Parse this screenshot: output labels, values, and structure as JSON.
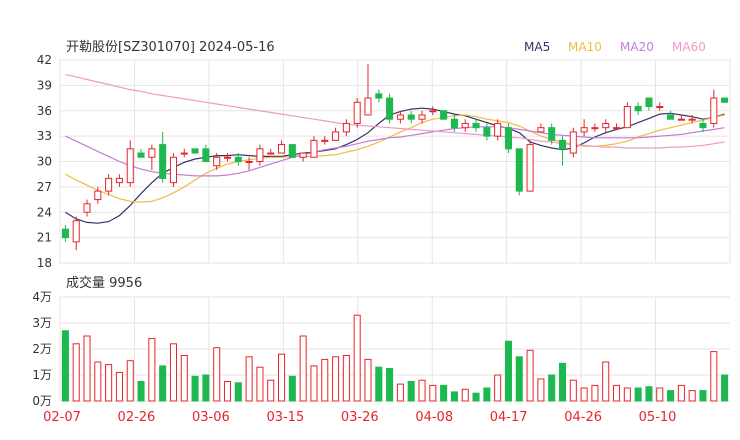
{
  "title": "开勒股份[SZ301070] 2024-05-16",
  "volume_title": "成交量 9956",
  "legend": [
    {
      "label": "MA5",
      "color": "#333366"
    },
    {
      "label": "MA10",
      "color": "#f5b942"
    },
    {
      "label": "MA20",
      "color": "#c27ed6"
    },
    {
      "label": "MA60",
      "color": "#f09ac8"
    }
  ],
  "colors": {
    "up": "#e8242a",
    "down": "#1fb850",
    "grid": "#e5e5e5"
  },
  "chart_data": [
    {
      "type": "candlestick",
      "ylim": [
        18,
        42
      ],
      "yticks": [
        "42",
        "39",
        "36",
        "33",
        "30",
        "27",
        "24",
        "21",
        "18"
      ],
      "xticks": [
        "02-07",
        "02-26",
        "03-06",
        "03-15",
        "03-26",
        "04-08",
        "04-17",
        "04-26",
        "05-10"
      ],
      "ohlc": [
        [
          22.0,
          22.5,
          20.5,
          21.0
        ],
        [
          20.5,
          23.5,
          19.5,
          23.0
        ],
        [
          24.0,
          25.5,
          23.5,
          25.0
        ],
        [
          25.5,
          27.0,
          25.0,
          26.5
        ],
        [
          26.5,
          28.5,
          26.0,
          28.0
        ],
        [
          27.5,
          28.5,
          27.0,
          28.0
        ],
        [
          27.5,
          32.5,
          27.0,
          31.5
        ],
        [
          31.0,
          31.5,
          30.5,
          30.5
        ],
        [
          30.5,
          32.0,
          29.0,
          31.5
        ],
        [
          32.0,
          33.5,
          27.5,
          28.0
        ],
        [
          27.5,
          31.0,
          27.0,
          30.5
        ],
        [
          31.0,
          31.5,
          30.5,
          31.0
        ],
        [
          31.5,
          31.5,
          31.0,
          31.0
        ],
        [
          31.5,
          32.0,
          30.0,
          30.0
        ],
        [
          29.5,
          31.0,
          29.0,
          30.5
        ],
        [
          30.5,
          31.0,
          30.0,
          30.5
        ],
        [
          30.5,
          31.0,
          29.5,
          30.0
        ],
        [
          30.0,
          30.5,
          29.0,
          30.0
        ],
        [
          30.0,
          32.0,
          29.5,
          31.5
        ],
        [
          31.0,
          31.5,
          31.0,
          31.0
        ],
        [
          31.0,
          32.5,
          31.0,
          32.0
        ],
        [
          32.0,
          32.0,
          30.5,
          30.5
        ],
        [
          30.5,
          31.0,
          30.0,
          31.0
        ],
        [
          30.5,
          33.0,
          30.5,
          32.5
        ],
        [
          32.5,
          33.0,
          32.0,
          32.5
        ],
        [
          32.5,
          34.0,
          32.5,
          33.5
        ],
        [
          33.5,
          35.0,
          33.0,
          34.5
        ],
        [
          34.5,
          37.5,
          34.0,
          37.0
        ],
        [
          35.5,
          41.5,
          35.5,
          37.5
        ],
        [
          38.0,
          38.5,
          37.0,
          37.5
        ],
        [
          37.5,
          38.0,
          34.5,
          35.0
        ],
        [
          35.0,
          36.0,
          34.5,
          35.5
        ],
        [
          35.5,
          36.0,
          34.5,
          35.0
        ],
        [
          35.0,
          36.0,
          34.5,
          35.5
        ],
        [
          36.0,
          36.5,
          35.5,
          36.0
        ],
        [
          36.0,
          36.0,
          35.0,
          35.0
        ],
        [
          35.0,
          35.5,
          33.5,
          34.0
        ],
        [
          34.0,
          35.0,
          33.5,
          34.5
        ],
        [
          34.5,
          35.0,
          33.5,
          34.0
        ],
        [
          34.0,
          34.5,
          32.5,
          33.0
        ],
        [
          33.0,
          35.0,
          32.5,
          34.5
        ],
        [
          34.0,
          34.5,
          31.0,
          31.5
        ],
        [
          31.5,
          31.5,
          26.0,
          26.5
        ],
        [
          26.5,
          32.5,
          26.5,
          32.0
        ],
        [
          33.5,
          34.5,
          33.5,
          34.0
        ],
        [
          34.0,
          34.5,
          32.0,
          32.5
        ],
        [
          32.5,
          33.0,
          29.5,
          31.5
        ],
        [
          31.0,
          34.0,
          30.5,
          33.5
        ],
        [
          33.5,
          35.0,
          33.0,
          34.0
        ],
        [
          34.0,
          34.5,
          33.5,
          34.0
        ],
        [
          34.0,
          35.0,
          33.5,
          34.5
        ],
        [
          34.0,
          34.5,
          34.0,
          34.0
        ],
        [
          34.0,
          37.0,
          34.0,
          36.5
        ],
        [
          36.5,
          37.0,
          35.5,
          36.0
        ],
        [
          37.5,
          37.5,
          36.0,
          36.5
        ],
        [
          36.5,
          37.0,
          36.0,
          36.5
        ],
        [
          35.5,
          36.0,
          35.0,
          35.0
        ],
        [
          35.0,
          35.5,
          35.0,
          35.0
        ],
        [
          35.0,
          35.5,
          34.5,
          35.0
        ],
        [
          34.5,
          35.0,
          33.5,
          34.0
        ],
        [
          34.5,
          38.5,
          34.0,
          37.5
        ],
        [
          37.5,
          37.5,
          37.0,
          37.0
        ]
      ],
      "series": [
        {
          "name": "MA5",
          "values": [
            24.0,
            23.2,
            22.8,
            22.7,
            22.9,
            23.6,
            24.8,
            26.2,
            27.5,
            28.6,
            29.3,
            29.9,
            30.3,
            30.5,
            30.7,
            30.7,
            30.8,
            30.7,
            30.6,
            30.6,
            30.6,
            30.8,
            31.0,
            31.1,
            31.3,
            31.5,
            32.0,
            32.6,
            33.4,
            34.5,
            35.5,
            35.9,
            36.2,
            36.3,
            36.2,
            35.9,
            35.6,
            35.4,
            35.0,
            34.6,
            34.2,
            33.9,
            33.4,
            32.3,
            31.9,
            31.6,
            31.4,
            31.6,
            32.2,
            32.9,
            33.4,
            33.8,
            34.1,
            34.6,
            35.1,
            35.6,
            35.7,
            35.5,
            35.3,
            35.0,
            35.2,
            35.6
          ]
        },
        {
          "name": "MA10",
          "values": [
            28.5,
            27.8,
            27.2,
            26.6,
            26.1,
            25.6,
            25.3,
            25.2,
            25.3,
            25.7,
            26.3,
            27.0,
            27.8,
            28.6,
            29.2,
            29.7,
            30.0,
            30.2,
            30.4,
            30.5,
            30.5,
            30.6,
            30.6,
            30.6,
            30.7,
            30.8,
            31.1,
            31.4,
            31.8,
            32.3,
            32.9,
            33.5,
            34.0,
            34.6,
            35.0,
            35.2,
            35.4,
            35.5,
            35.3,
            35.0,
            34.8,
            34.6,
            34.2,
            33.6,
            33.0,
            32.6,
            32.3,
            32.0,
            31.8,
            31.8,
            31.9,
            32.1,
            32.4,
            32.9,
            33.3,
            33.7,
            34.0,
            34.3,
            34.6,
            34.9,
            35.2,
            35.5
          ]
        },
        {
          "name": "MA20",
          "values": [
            33.0,
            32.4,
            31.8,
            31.2,
            30.6,
            30.0,
            29.5,
            29.1,
            28.8,
            28.6,
            28.5,
            28.4,
            28.3,
            28.3,
            28.3,
            28.4,
            28.6,
            28.9,
            29.3,
            29.7,
            30.1,
            30.5,
            30.8,
            31.1,
            31.4,
            31.6,
            31.8,
            32.1,
            32.4,
            32.6,
            32.8,
            32.9,
            33.1,
            33.3,
            33.5,
            33.7,
            33.9,
            34.0,
            34.1,
            34.1,
            34.1,
            34.0,
            33.8,
            33.6,
            33.4,
            33.2,
            33.1,
            33.0,
            32.9,
            32.8,
            32.8,
            32.8,
            32.8,
            32.8,
            32.9,
            33.0,
            33.1,
            33.2,
            33.4,
            33.6,
            33.8,
            34.0
          ]
        },
        {
          "name": "MA60",
          "values": [
            40.3,
            40.0,
            39.7,
            39.4,
            39.1,
            38.8,
            38.5,
            38.3,
            38.0,
            37.8,
            37.6,
            37.4,
            37.2,
            37.0,
            36.8,
            36.6,
            36.4,
            36.2,
            36.0,
            35.8,
            35.6,
            35.4,
            35.2,
            35.0,
            34.8,
            34.6,
            34.4,
            34.3,
            34.2,
            34.1,
            34.0,
            33.9,
            33.8,
            33.7,
            33.6,
            33.5,
            33.4,
            33.3,
            33.2,
            33.1,
            33.0,
            32.9,
            32.8,
            32.6,
            32.4,
            32.3,
            32.1,
            32.0,
            31.9,
            31.8,
            31.7,
            31.7,
            31.6,
            31.6,
            31.6,
            31.6,
            31.7,
            31.7,
            31.8,
            31.9,
            32.1,
            32.3
          ]
        }
      ]
    },
    {
      "type": "bar",
      "ylim": [
        0,
        40000
      ],
      "yticks": [
        "4万",
        "3万",
        "2万",
        "1万",
        "0万"
      ],
      "values": [
        27000,
        22000,
        25000,
        15000,
        14000,
        11000,
        15500,
        7500,
        24000,
        13500,
        22000,
        17500,
        9500,
        10000,
        20500,
        7500,
        7000,
        17000,
        13000,
        8000,
        18000,
        9500,
        25000,
        13500,
        16000,
        17000,
        17500,
        33000,
        16000,
        13000,
        12500,
        6500,
        7500,
        8000,
        6000,
        6000,
        3500,
        4500,
        3000,
        5000,
        10000,
        23000,
        17000,
        19500,
        8500,
        10000,
        14500,
        8000,
        5000,
        6000,
        15000,
        6000,
        5000,
        5000,
        5500,
        5000,
        4000,
        6000,
        4000,
        4000,
        19000,
        10000
      ]
    }
  ]
}
